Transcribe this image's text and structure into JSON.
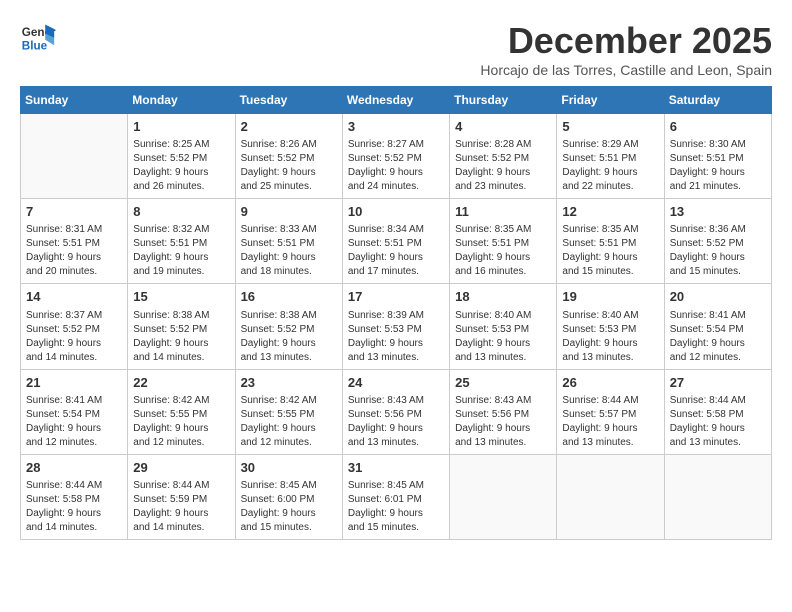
{
  "logo": {
    "line1": "General",
    "line2": "Blue"
  },
  "title": "December 2025",
  "subtitle": "Horcajo de las Torres, Castille and Leon, Spain",
  "days_header": [
    "Sunday",
    "Monday",
    "Tuesday",
    "Wednesday",
    "Thursday",
    "Friday",
    "Saturday"
  ],
  "weeks": [
    [
      {
        "day": "",
        "info": ""
      },
      {
        "day": "1",
        "info": "Sunrise: 8:25 AM\nSunset: 5:52 PM\nDaylight: 9 hours\nand 26 minutes."
      },
      {
        "day": "2",
        "info": "Sunrise: 8:26 AM\nSunset: 5:52 PM\nDaylight: 9 hours\nand 25 minutes."
      },
      {
        "day": "3",
        "info": "Sunrise: 8:27 AM\nSunset: 5:52 PM\nDaylight: 9 hours\nand 24 minutes."
      },
      {
        "day": "4",
        "info": "Sunrise: 8:28 AM\nSunset: 5:52 PM\nDaylight: 9 hours\nand 23 minutes."
      },
      {
        "day": "5",
        "info": "Sunrise: 8:29 AM\nSunset: 5:51 PM\nDaylight: 9 hours\nand 22 minutes."
      },
      {
        "day": "6",
        "info": "Sunrise: 8:30 AM\nSunset: 5:51 PM\nDaylight: 9 hours\nand 21 minutes."
      }
    ],
    [
      {
        "day": "7",
        "info": "Sunrise: 8:31 AM\nSunset: 5:51 PM\nDaylight: 9 hours\nand 20 minutes."
      },
      {
        "day": "8",
        "info": "Sunrise: 8:32 AM\nSunset: 5:51 PM\nDaylight: 9 hours\nand 19 minutes."
      },
      {
        "day": "9",
        "info": "Sunrise: 8:33 AM\nSunset: 5:51 PM\nDaylight: 9 hours\nand 18 minutes."
      },
      {
        "day": "10",
        "info": "Sunrise: 8:34 AM\nSunset: 5:51 PM\nDaylight: 9 hours\nand 17 minutes."
      },
      {
        "day": "11",
        "info": "Sunrise: 8:35 AM\nSunset: 5:51 PM\nDaylight: 9 hours\nand 16 minutes."
      },
      {
        "day": "12",
        "info": "Sunrise: 8:35 AM\nSunset: 5:51 PM\nDaylight: 9 hours\nand 15 minutes."
      },
      {
        "day": "13",
        "info": "Sunrise: 8:36 AM\nSunset: 5:52 PM\nDaylight: 9 hours\nand 15 minutes."
      }
    ],
    [
      {
        "day": "14",
        "info": "Sunrise: 8:37 AM\nSunset: 5:52 PM\nDaylight: 9 hours\nand 14 minutes."
      },
      {
        "day": "15",
        "info": "Sunrise: 8:38 AM\nSunset: 5:52 PM\nDaylight: 9 hours\nand 14 minutes."
      },
      {
        "day": "16",
        "info": "Sunrise: 8:38 AM\nSunset: 5:52 PM\nDaylight: 9 hours\nand 13 minutes."
      },
      {
        "day": "17",
        "info": "Sunrise: 8:39 AM\nSunset: 5:53 PM\nDaylight: 9 hours\nand 13 minutes."
      },
      {
        "day": "18",
        "info": "Sunrise: 8:40 AM\nSunset: 5:53 PM\nDaylight: 9 hours\nand 13 minutes."
      },
      {
        "day": "19",
        "info": "Sunrise: 8:40 AM\nSunset: 5:53 PM\nDaylight: 9 hours\nand 13 minutes."
      },
      {
        "day": "20",
        "info": "Sunrise: 8:41 AM\nSunset: 5:54 PM\nDaylight: 9 hours\nand 12 minutes."
      }
    ],
    [
      {
        "day": "21",
        "info": "Sunrise: 8:41 AM\nSunset: 5:54 PM\nDaylight: 9 hours\nand 12 minutes."
      },
      {
        "day": "22",
        "info": "Sunrise: 8:42 AM\nSunset: 5:55 PM\nDaylight: 9 hours\nand 12 minutes."
      },
      {
        "day": "23",
        "info": "Sunrise: 8:42 AM\nSunset: 5:55 PM\nDaylight: 9 hours\nand 12 minutes."
      },
      {
        "day": "24",
        "info": "Sunrise: 8:43 AM\nSunset: 5:56 PM\nDaylight: 9 hours\nand 13 minutes."
      },
      {
        "day": "25",
        "info": "Sunrise: 8:43 AM\nSunset: 5:56 PM\nDaylight: 9 hours\nand 13 minutes."
      },
      {
        "day": "26",
        "info": "Sunrise: 8:44 AM\nSunset: 5:57 PM\nDaylight: 9 hours\nand 13 minutes."
      },
      {
        "day": "27",
        "info": "Sunrise: 8:44 AM\nSunset: 5:58 PM\nDaylight: 9 hours\nand 13 minutes."
      }
    ],
    [
      {
        "day": "28",
        "info": "Sunrise: 8:44 AM\nSunset: 5:58 PM\nDaylight: 9 hours\nand 14 minutes."
      },
      {
        "day": "29",
        "info": "Sunrise: 8:44 AM\nSunset: 5:59 PM\nDaylight: 9 hours\nand 14 minutes."
      },
      {
        "day": "30",
        "info": "Sunrise: 8:45 AM\nSunset: 6:00 PM\nDaylight: 9 hours\nand 15 minutes."
      },
      {
        "day": "31",
        "info": "Sunrise: 8:45 AM\nSunset: 6:01 PM\nDaylight: 9 hours\nand 15 minutes."
      },
      {
        "day": "",
        "info": ""
      },
      {
        "day": "",
        "info": ""
      },
      {
        "day": "",
        "info": ""
      }
    ]
  ]
}
